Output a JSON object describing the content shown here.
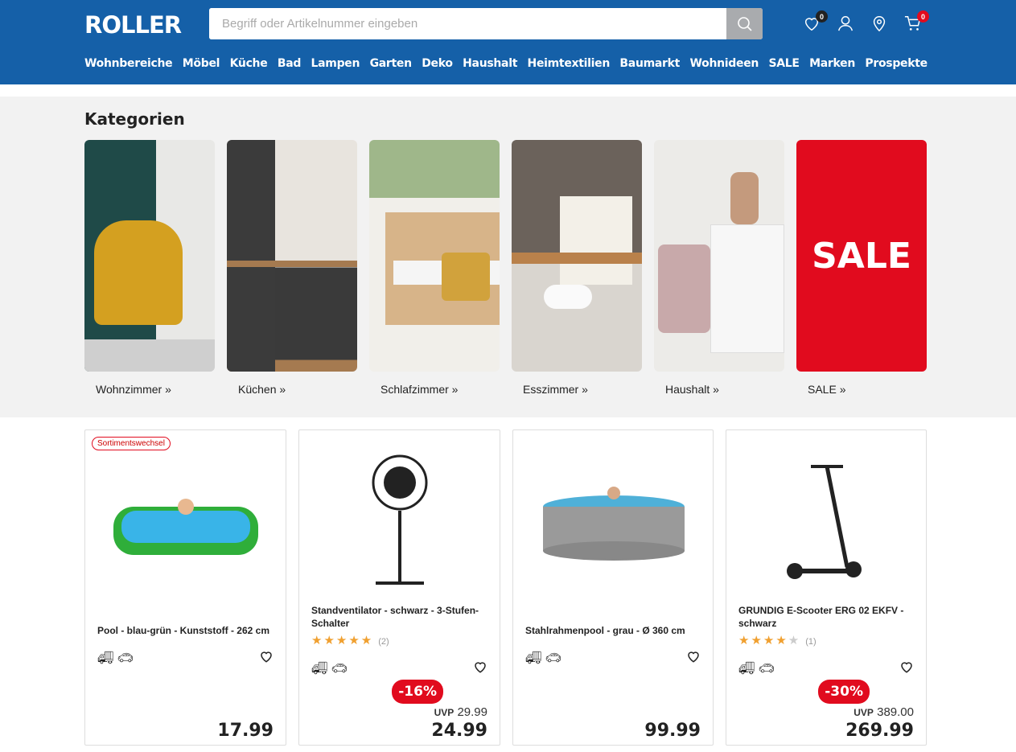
{
  "header": {
    "logo": "ROLLER",
    "search_placeholder": "Begriff oder Artikelnummer eingeben",
    "wishlist_count": "0",
    "cart_count": "0"
  },
  "nav": [
    "Wohnbereiche",
    "Möbel",
    "Küche",
    "Bad",
    "Lampen",
    "Garten",
    "Deko",
    "Haushalt",
    "Heimtextilien",
    "Baumarkt",
    "Wohnideen",
    "SALE",
    "Marken",
    "Prospekte"
  ],
  "categories": {
    "title": "Kategorien",
    "items": [
      {
        "label": "Wohnzimmer »"
      },
      {
        "label": "Küchen »"
      },
      {
        "label": "Schlafzimmer »"
      },
      {
        "label": "Esszimmer »"
      },
      {
        "label": "Haushalt »"
      },
      {
        "label": "SALE »",
        "tile_text": "SALE"
      }
    ]
  },
  "products": [
    {
      "tag": "Sortimentswechsel",
      "name": "Pool - blau-grün - Kunststoff - 262 cm",
      "price": "17.99"
    },
    {
      "name": "Standventilator - schwarz - 3-Stufen-Schalter",
      "rating": 5,
      "reviews": "(2)",
      "discount": "-16%",
      "uvp_label": "UVP",
      "uvp": "29.99",
      "price": "24.99"
    },
    {
      "name": "Stahlrahmenpool - grau - Ø 360 cm",
      "price": "99.99"
    },
    {
      "name": "GRUNDIG E-Scooter ERG 02 EKFV - schwarz",
      "rating": 4,
      "reviews": "(1)",
      "discount": "-30%",
      "uvp_label": "UVP",
      "uvp": "389.00",
      "price": "269.99"
    }
  ],
  "colors": {
    "brand": "#1560a8",
    "sale": "#e10b1e",
    "star": "#f0a030"
  }
}
